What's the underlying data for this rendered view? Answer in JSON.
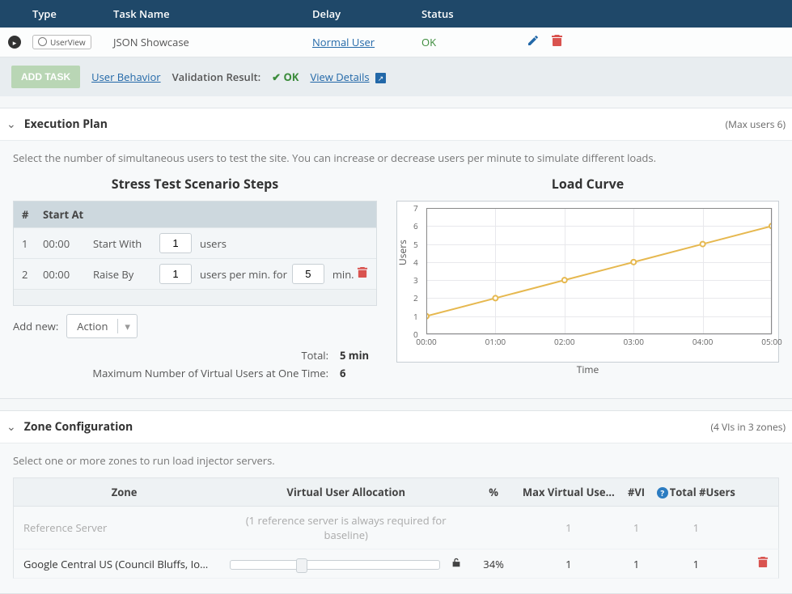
{
  "tasks": {
    "headers": {
      "type": "Type",
      "name": "Task Name",
      "delay": "Delay",
      "status": "Status"
    },
    "row": {
      "type_badge": "UserView",
      "name": "JSON Showcase",
      "delay": "Normal User",
      "status": "OK"
    }
  },
  "toolbar": {
    "add_task": "ADD TASK",
    "user_behavior": "User Behavior",
    "validation_label": "Validation Result:",
    "validation_value": "OK",
    "view_details": "View Details"
  },
  "exec_plan": {
    "title": "Execution Plan",
    "meta": "(Max users 6)",
    "desc": "Select the number of simultaneous users to test the site. You can increase or decrease users per minute to simulate different loads.",
    "steps_title": "Stress Test Scenario Steps",
    "headers": {
      "num": "#",
      "start_at": "Start At"
    },
    "rows": [
      {
        "num": "1",
        "time": "00:00",
        "label": "Start With",
        "value": "1",
        "unit": "users"
      },
      {
        "num": "2",
        "time": "00:00",
        "label": "Raise By",
        "value": "1",
        "unit": "users per min. for",
        "value2": "5",
        "unit2": "min."
      }
    ],
    "add_new_label": "Add new:",
    "action_select": "Action",
    "totals": {
      "total_label": "Total:",
      "total_value": "5 min",
      "max_label": "Maximum Number of Virtual Users at One Time:",
      "max_value": "6"
    },
    "load_curve_title": "Load Curve"
  },
  "chart_data": {
    "type": "line",
    "title": "Load Curve",
    "xlabel": "Time",
    "ylabel": "Users",
    "x": [
      "00:00",
      "01:00",
      "02:00",
      "03:00",
      "04:00",
      "05:00"
    ],
    "y_ticks": [
      0,
      1,
      2,
      3,
      4,
      5,
      6,
      7
    ],
    "ylim": [
      0,
      7
    ],
    "series": [
      {
        "name": "Users",
        "values": [
          1,
          2,
          3,
          4,
          5,
          6
        ],
        "color": "#e6b84f"
      }
    ]
  },
  "zone": {
    "title": "Zone Configuration",
    "meta": "(4 VIs in 3 zones)",
    "desc": "Select one or more zones to run load injector servers.",
    "headers": {
      "zone": "Zone",
      "alloc": "Virtual User Allocation",
      "pct": "%",
      "max": "Max Virtual Use…",
      "vi": "#VI",
      "total": "Total #Users"
    },
    "rows": [
      {
        "zone": "Reference Server",
        "alloc_note": "(1 reference server is always required for baseline)",
        "pct": "",
        "max": "1",
        "vi": "1",
        "total": "1",
        "muted": true
      },
      {
        "zone": "Google Central US (Council Bluffs, Io…",
        "slider_pct": 34,
        "pct": "34%",
        "max": "1",
        "vi": "1",
        "total": "1"
      }
    ]
  }
}
